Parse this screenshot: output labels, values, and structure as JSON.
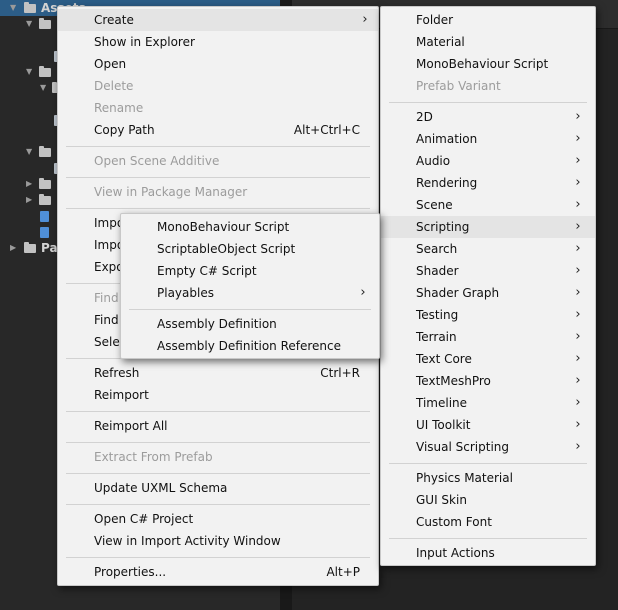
{
  "project": {
    "root_label": "Assets",
    "packages_label": "Pa"
  },
  "menu_main": {
    "items": [
      {
        "label": "Create"
      },
      {
        "label": "Show in Explorer"
      },
      {
        "label": "Open"
      },
      {
        "label": "Delete"
      },
      {
        "label": "Rename"
      },
      {
        "label": "Copy Path",
        "shortcut": "Alt+Ctrl+C"
      },
      {
        "label": "Open Scene Additive"
      },
      {
        "label": "View in Package Manager"
      },
      {
        "label": "Impo"
      },
      {
        "label": "Impo"
      },
      {
        "label": "Expo"
      },
      {
        "label": "Find"
      },
      {
        "label": "Find"
      },
      {
        "label": "Selec"
      },
      {
        "label": "Refresh",
        "shortcut": "Ctrl+R"
      },
      {
        "label": "Reimport"
      },
      {
        "label": "Reimport All"
      },
      {
        "label": "Extract From Prefab"
      },
      {
        "label": "Update UXML Schema"
      },
      {
        "label": "Open C# Project"
      },
      {
        "label": "View in Import Activity Window"
      },
      {
        "label": "Properties...",
        "shortcut": "Alt+P"
      }
    ]
  },
  "menu_create": {
    "items": [
      {
        "label": "Folder"
      },
      {
        "label": "Material"
      },
      {
        "label": "MonoBehaviour Script"
      },
      {
        "label": "Prefab Variant"
      },
      {
        "label": "2D"
      },
      {
        "label": "Animation"
      },
      {
        "label": "Audio"
      },
      {
        "label": "Rendering"
      },
      {
        "label": "Scene"
      },
      {
        "label": "Scripting"
      },
      {
        "label": "Search"
      },
      {
        "label": "Shader"
      },
      {
        "label": "Shader Graph"
      },
      {
        "label": "Testing"
      },
      {
        "label": "Terrain"
      },
      {
        "label": "Text Core"
      },
      {
        "label": "TextMeshPro"
      },
      {
        "label": "Timeline"
      },
      {
        "label": "UI Toolkit"
      },
      {
        "label": "Visual Scripting"
      },
      {
        "label": "Physics Material"
      },
      {
        "label": "GUI Skin"
      },
      {
        "label": "Custom Font"
      },
      {
        "label": "Input Actions"
      }
    ]
  },
  "menu_scripting": {
    "items": [
      {
        "label": "MonoBehaviour Script"
      },
      {
        "label": "ScriptableObject Script"
      },
      {
        "label": "Empty C# Script"
      },
      {
        "label": "Playables"
      },
      {
        "label": "Assembly Definition"
      },
      {
        "label": "Assembly Definition Reference"
      }
    ]
  },
  "icons": {
    "submenu_arrow": "chevron-right-icon",
    "folder": "folder-icon"
  },
  "colors": {
    "menu_bg": "#f2f2f2",
    "highlight": "#e4e4e4",
    "disabled_text": "#9c9c9c",
    "selection": "#2c5d87"
  }
}
